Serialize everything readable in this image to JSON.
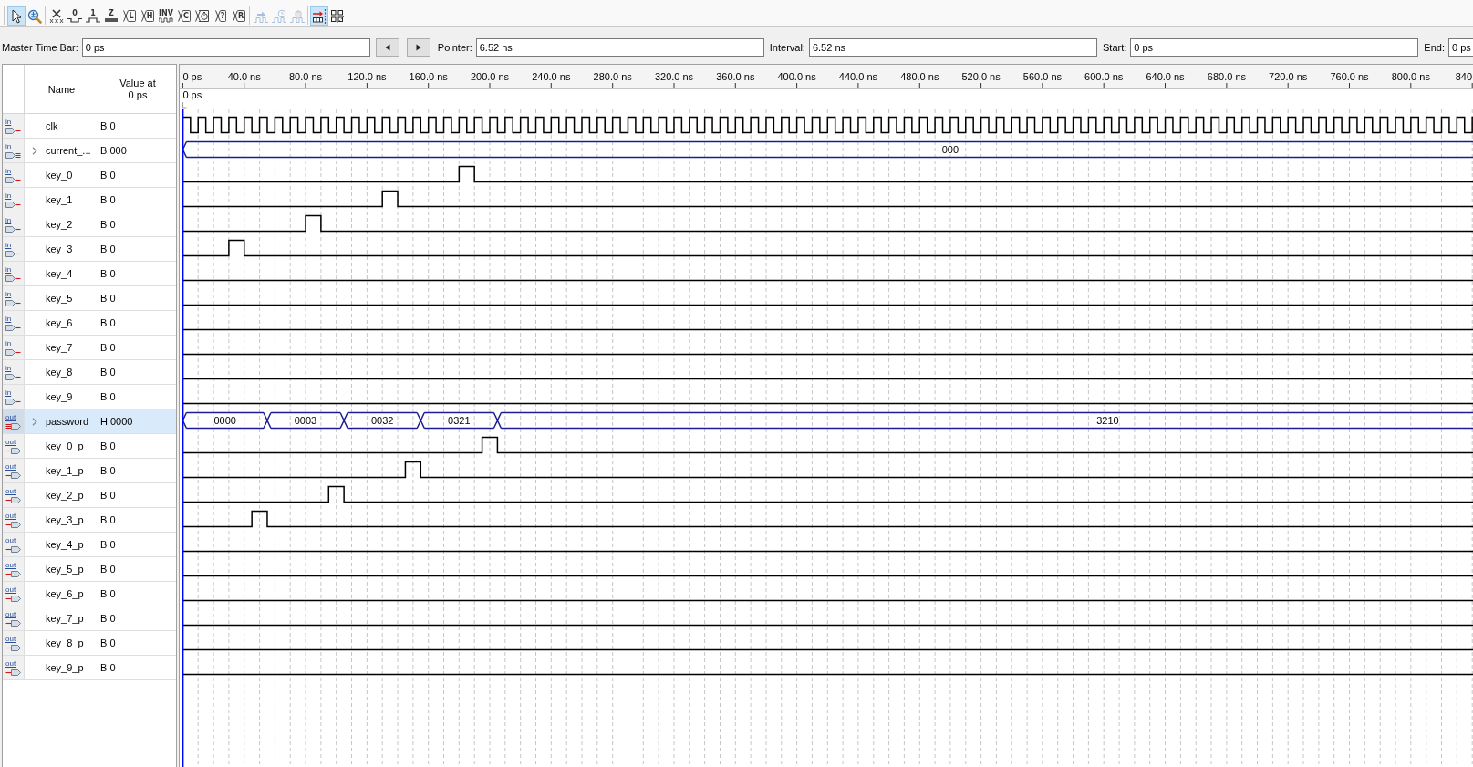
{
  "toolbar": [
    [
      {
        "kind": "pointer",
        "selected": true,
        "disabled": false
      },
      {
        "kind": "zoom",
        "selected": false,
        "disabled": false
      }
    ],
    [
      {
        "kind": "force-unknown",
        "selected": false,
        "disabled": false
      },
      {
        "kind": "level-low",
        "glyph": "0",
        "selected": false,
        "disabled": false
      },
      {
        "kind": "level-high",
        "glyph": "1",
        "selected": false,
        "disabled": false
      },
      {
        "kind": "level-bar",
        "glyph": "Z",
        "selected": false,
        "disabled": false
      },
      {
        "kind": "bus-letter",
        "glyph": "L",
        "selected": false,
        "disabled": false
      },
      {
        "kind": "bus-letter",
        "glyph": "H",
        "selected": false,
        "disabled": false
      },
      {
        "kind": "letter-wave",
        "glyph": "INV",
        "selected": false,
        "disabled": false
      },
      {
        "kind": "bus-letter",
        "glyph": "C",
        "selected": false,
        "disabled": false
      },
      {
        "kind": "bus-clock",
        "selected": false,
        "disabled": false
      },
      {
        "kind": "bus-letter",
        "glyph": "?",
        "selected": false,
        "disabled": false
      },
      {
        "kind": "bus-letter",
        "glyph": "R",
        "selected": false,
        "disabled": false
      }
    ],
    [
      {
        "kind": "wave-arrow",
        "selected": false,
        "disabled": true
      },
      {
        "kind": "wave-clock",
        "selected": false,
        "disabled": true
      },
      {
        "kind": "wave-hand",
        "selected": false,
        "disabled": true
      }
    ],
    [
      {
        "kind": "marker-snap",
        "selected": true,
        "disabled": false
      },
      {
        "kind": "grid-marker",
        "selected": false,
        "disabled": false
      }
    ]
  ],
  "time_bar": {
    "fields": [
      {
        "label": "Master Time Bar:",
        "value": "0 ps"
      },
      {
        "label": "Pointer:",
        "value": "6.52 ns"
      },
      {
        "label": "Interval:",
        "value": "6.52 ns"
      },
      {
        "label": "Start:",
        "value": "0 ps"
      },
      {
        "label": "End:",
        "value": "0 ps"
      }
    ]
  },
  "signal_list": {
    "columns": {
      "name": "Name",
      "value": "Value at 0 ps"
    },
    "signals": [
      {
        "pin_label": "in",
        "kind": "input-bit",
        "name": "clk",
        "value": "B 0",
        "selected": false
      },
      {
        "pin_label": "in",
        "kind": "input-bus",
        "expanded": false,
        "name": "current_...",
        "value": "B 000",
        "selected": false,
        "bus_values": [
          "000"
        ]
      },
      {
        "pin_label": "in",
        "kind": "input-bit",
        "name": "key_0",
        "value": "B 0",
        "selected": false
      },
      {
        "pin_label": "in",
        "kind": "input-bit",
        "name": "key_1",
        "value": "B 0",
        "selected": false
      },
      {
        "pin_label": "in",
        "kind": "input-bit",
        "name": "key_2",
        "value": "B 0",
        "selected": false
      },
      {
        "pin_label": "in",
        "kind": "input-bit",
        "name": "key_3",
        "value": "B 0",
        "selected": false
      },
      {
        "pin_label": "in",
        "kind": "input-bit",
        "name": "key_4",
        "value": "B 0",
        "selected": false
      },
      {
        "pin_label": "in",
        "kind": "input-bit",
        "name": "key_5",
        "value": "B 0",
        "selected": false
      },
      {
        "pin_label": "in",
        "kind": "input-bit",
        "name": "key_6",
        "value": "B 0",
        "selected": false
      },
      {
        "pin_label": "in",
        "kind": "input-bit",
        "name": "key_7",
        "value": "B 0",
        "selected": false
      },
      {
        "pin_label": "in",
        "kind": "input-bit",
        "name": "key_8",
        "value": "B 0",
        "selected": false
      },
      {
        "pin_label": "in",
        "kind": "input-bit",
        "name": "key_9",
        "value": "B 0",
        "selected": false
      },
      {
        "pin_label": "out",
        "kind": "output-bus",
        "expanded": false,
        "name": "password",
        "value": "H 0000",
        "selected": true,
        "bus_values": [
          "0000",
          "0003",
          "0032",
          "0321",
          "3210"
        ]
      },
      {
        "pin_label": "out",
        "kind": "output-bit",
        "name": "key_0_p",
        "value": "B 0",
        "selected": false
      },
      {
        "pin_label": "out",
        "kind": "output-bit",
        "name": "key_1_p",
        "value": "B 0",
        "selected": false
      },
      {
        "pin_label": "out",
        "kind": "output-bit",
        "name": "key_2_p",
        "value": "B 0",
        "selected": false
      },
      {
        "pin_label": "out",
        "kind": "output-bit",
        "name": "key_3_p",
        "value": "B 0",
        "selected": false
      },
      {
        "pin_label": "out",
        "kind": "output-bit",
        "name": "key_4_p",
        "value": "B 0",
        "selected": false
      },
      {
        "pin_label": "out",
        "kind": "output-bit",
        "name": "key_5_p",
        "value": "B 0",
        "selected": false
      },
      {
        "pin_label": "out",
        "kind": "output-bit",
        "name": "key_6_p",
        "value": "B 0",
        "selected": false
      },
      {
        "pin_label": "out",
        "kind": "output-bit",
        "name": "key_7_p",
        "value": "B 0",
        "selected": false
      },
      {
        "pin_label": "out",
        "kind": "output-bit",
        "name": "key_8_p",
        "value": "B 0",
        "selected": false
      },
      {
        "pin_label": "out",
        "kind": "output-bit",
        "name": "key_9_p",
        "value": "B 0",
        "selected": false
      }
    ]
  },
  "waveform": {
    "time_ticks": [
      "0 ps",
      "40.0 ns",
      "80.0 ns",
      "120.0 ns",
      "160.0 ns",
      "200.0 ns",
      "240.0 ns",
      "280.0 ns",
      "320.0 ns",
      "360.0 ns",
      "400.0 ns",
      "440.0 ns",
      "480.0 ns",
      "520.0 ns",
      "560.0 ns",
      "600.0 ns",
      "640.0 ns",
      "680.0 ns",
      "720.0 ns",
      "760.0 ns",
      "800.0 ns",
      "840"
    ],
    "cursor_label": "0 ps"
  }
}
